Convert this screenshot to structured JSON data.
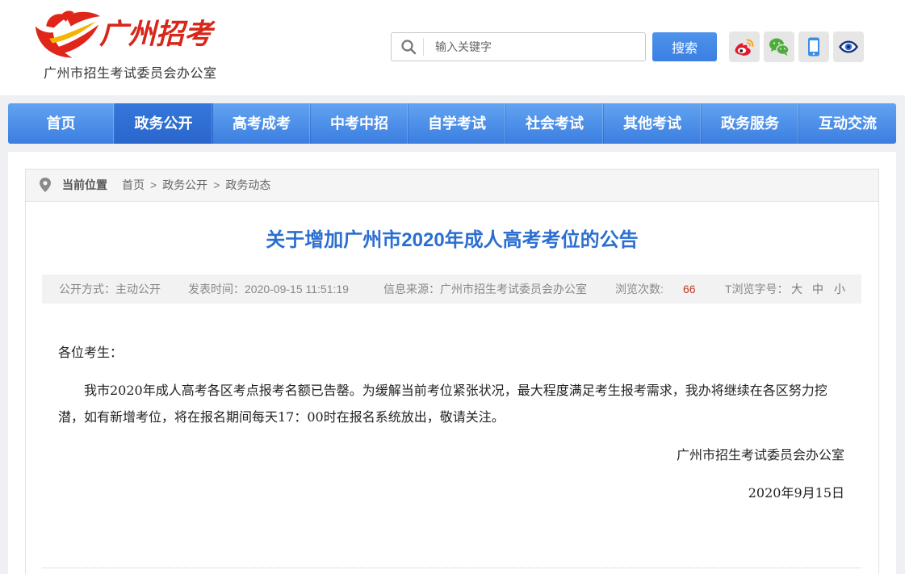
{
  "header": {
    "logo_text": "广州招考",
    "org_name": "广州市招生考试委员会办公室",
    "search": {
      "icon": "search-icon",
      "placeholder": "输入关键字",
      "button_label": "搜索"
    },
    "social_icons": [
      "weibo-icon",
      "wechat-icon",
      "mobile-icon",
      "eye-icon"
    ]
  },
  "nav": {
    "items": [
      {
        "label": "首页",
        "active": false
      },
      {
        "label": "政务公开",
        "active": true
      },
      {
        "label": "高考成考",
        "active": false
      },
      {
        "label": "中考中招",
        "active": false
      },
      {
        "label": "自学考试",
        "active": false
      },
      {
        "label": "社会考试",
        "active": false
      },
      {
        "label": "其他考试",
        "active": false
      },
      {
        "label": "政务服务",
        "active": false
      },
      {
        "label": "互动交流",
        "active": false
      }
    ]
  },
  "breadcrumb": {
    "icon": "location-pin-icon",
    "prefix": "当前位置",
    "separator": ">",
    "items": [
      "首页",
      "政务公开",
      "政务动态"
    ]
  },
  "article": {
    "title": "关于增加广州市2020年成人高考考位的公告",
    "meta": {
      "disclosure": {
        "label": "公开方式：",
        "value": "主动公开"
      },
      "published": {
        "label": "发表时间：",
        "value": "2020-09-15 11:51:19"
      },
      "source": {
        "label": "信息来源：",
        "value": "广州市招生考试委员会办公室"
      },
      "views": {
        "label": "浏览次数:",
        "value": "66"
      },
      "font_size": {
        "label": "T浏览字号：",
        "options": [
          "大",
          "中",
          "小"
        ]
      }
    },
    "greeting": "各位考生：",
    "paragraphs": [
      "我市2020年成人高考各区考点报考名额已告罄。为缓解当前考位紧张状况，最大程度满足考生报考需求，我办将继续在各区努力挖潜，如有新增考位，将在报名期间每天17：00时在报名系统放出，敬请关注。"
    ],
    "signature": "广州市招生考试委员会办公室",
    "date": "2020年9月15日"
  },
  "colors": {
    "brand_red": "#d8261a",
    "nav_top": "#62a3f1",
    "nav_bottom": "#3b7ee0",
    "nav_active_top": "#3577db",
    "nav_active_bottom": "#2a66cc",
    "title_blue": "#2c6fd1",
    "views_red": "#c0392b",
    "page_bg": "#eef0f3"
  }
}
